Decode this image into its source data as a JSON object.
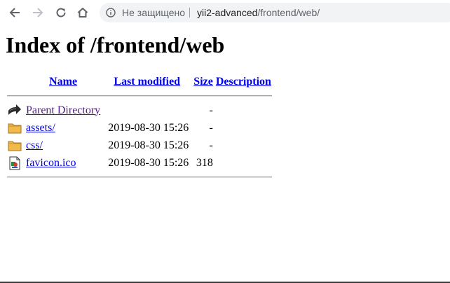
{
  "browser": {
    "security_label": "Не защищено",
    "url_host": "yii2-advanced",
    "url_path": "/frontend/web/",
    "icons": [
      "back-arrow-icon",
      "forward-arrow-icon",
      "reload-icon",
      "home-icon",
      "info-icon"
    ]
  },
  "page": {
    "title": "Index of /frontend/web",
    "columns": {
      "name": "Name",
      "last_modified": "Last modified",
      "size": "Size",
      "description": "Description"
    },
    "rows": [
      {
        "name": "Parent Directory",
        "modified": "",
        "size": "-",
        "description": "",
        "icon": "back-arrow-icon"
      },
      {
        "name": "assets/",
        "modified": "2019-08-30 15:26",
        "size": "-",
        "description": "",
        "icon": "folder-icon"
      },
      {
        "name": "css/",
        "modified": "2019-08-30 15:26",
        "size": "-",
        "description": "",
        "icon": "folder-icon"
      },
      {
        "name": "favicon.ico",
        "modified": "2019-08-30 15:26",
        "size": "318",
        "description": "",
        "icon": "image-file-icon"
      }
    ]
  },
  "colors": {
    "link": "#0000ee",
    "visited_link": "#551a8b",
    "omnibox_bg": "#f1f3f4"
  }
}
